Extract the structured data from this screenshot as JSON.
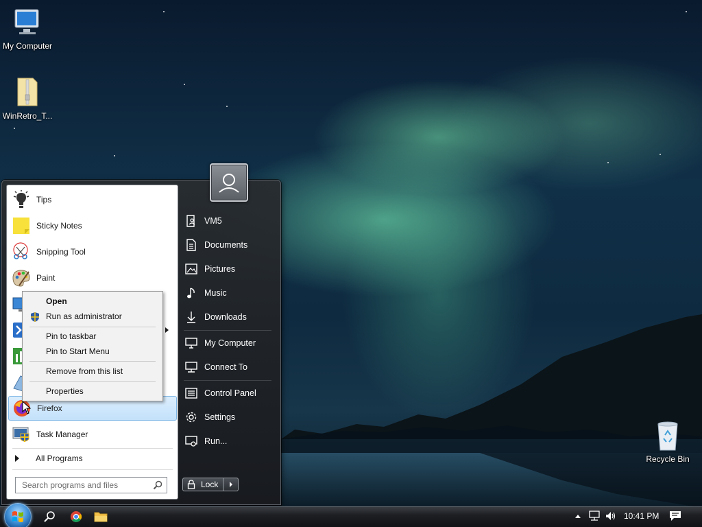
{
  "desktop": {
    "icons": [
      {
        "label": "My Computer"
      },
      {
        "label": "WinRetro_T..."
      },
      {
        "label": "Recycle Bin"
      }
    ]
  },
  "start_menu": {
    "programs": [
      {
        "label": "Tips",
        "icon": "lightbulb-icon"
      },
      {
        "label": "Sticky Notes",
        "icon": "sticky-notes-icon"
      },
      {
        "label": "Snipping Tool",
        "icon": "scissors-icon"
      },
      {
        "label": "Paint",
        "icon": "paint-palette-icon"
      },
      {
        "label": "",
        "icon": "monitor-icon"
      },
      {
        "label": "",
        "icon": "powershell-icon"
      },
      {
        "label": "",
        "icon": "chart-icon"
      },
      {
        "label": "",
        "icon": "notepad-icon"
      },
      {
        "label": "Firefox",
        "icon": "firefox-icon"
      },
      {
        "label": "Task Manager",
        "icon": "task-manager-icon"
      }
    ],
    "all_programs": "All Programs",
    "search_placeholder": "Search programs and files",
    "right_items": [
      {
        "label": "VM5",
        "icon": "user-folder-icon"
      },
      {
        "label": "Documents",
        "icon": "document-icon"
      },
      {
        "label": "Pictures",
        "icon": "picture-icon"
      },
      {
        "label": "Music",
        "icon": "music-note-icon"
      },
      {
        "label": "Downloads",
        "icon": "download-arrow-icon"
      },
      {
        "label": "My Computer",
        "icon": "computer-icon"
      },
      {
        "label": "Connect To",
        "icon": "network-icon"
      },
      {
        "label": "Control Panel",
        "icon": "control-panel-icon"
      },
      {
        "label": "Settings",
        "icon": "gear-icon"
      },
      {
        "label": "Run...",
        "icon": "run-icon"
      }
    ],
    "lock_label": "Lock"
  },
  "context_menu": {
    "items": [
      {
        "label": "Open"
      },
      {
        "label": "Run as administrator"
      },
      {
        "label": "Pin to taskbar"
      },
      {
        "label": "Pin to Start Menu"
      },
      {
        "label": "Remove from this list"
      },
      {
        "label": "Properties"
      }
    ]
  },
  "taskbar": {
    "time": "10:41 PM"
  },
  "colors": {
    "selection": "#c3e1fb",
    "menu_dark": "#24272b",
    "aurora": "#6fdca8"
  }
}
